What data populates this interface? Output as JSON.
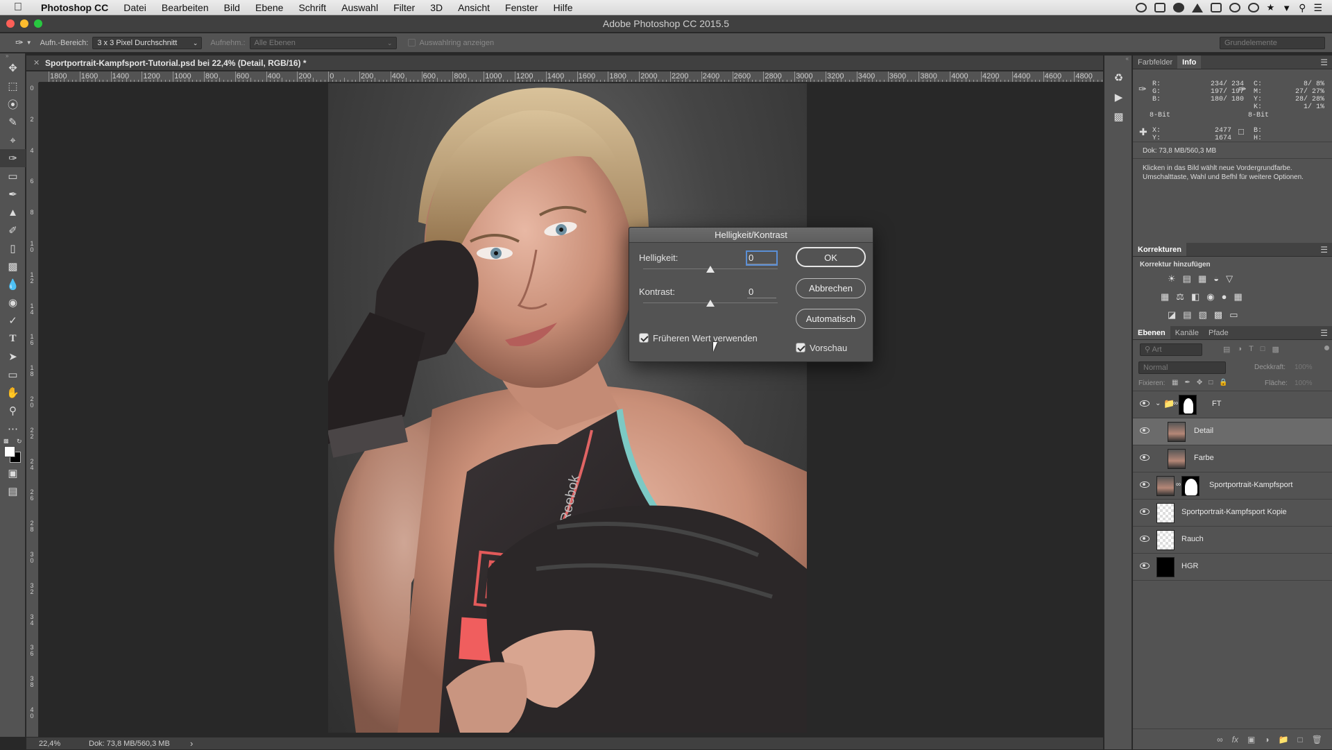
{
  "menubar": {
    "items": [
      "Photoshop CC",
      "Datei",
      "Bearbeiten",
      "Bild",
      "Ebene",
      "Schrift",
      "Auswahl",
      "Filter",
      "3D",
      "Ansicht",
      "Fenster",
      "Hilfe"
    ]
  },
  "window": {
    "title": "Adobe Photoshop CC 2015.5"
  },
  "options": {
    "sample_size_label": "Aufn.-Bereich:",
    "sample_size_value": "3 x 3 Pixel Durchschnitt",
    "sample_label": "Aufnehm.:",
    "sample_value": "Alle Ebenen",
    "show_ring_label": "Auswahlring anzeigen",
    "workspace": "Grundelemente"
  },
  "document": {
    "tab_title": "Sportportrait-Kampfsport-Tutorial.psd bei 22,4% (Detail, RGB/16) *",
    "ruler_h": [
      "1800",
      "1600",
      "1400",
      "1200",
      "1000",
      "800",
      "600",
      "400",
      "200",
      "0",
      "200",
      "400",
      "600",
      "800",
      "1000",
      "1200",
      "1400",
      "1600",
      "1800",
      "2000",
      "2200",
      "2400",
      "2600",
      "2800",
      "3000",
      "3200",
      "3400",
      "3600",
      "3800",
      "4000",
      "4200",
      "4400",
      "4600",
      "4800"
    ],
    "ruler_v": [
      "0",
      "2",
      "4",
      "6",
      "8",
      "1 0",
      "1 2",
      "1 4",
      "1 6",
      "1 8",
      "2 0",
      "2 2",
      "2 4",
      "2 6",
      "2 8",
      "3 0",
      "3 2",
      "3 4",
      "3 6",
      "3 8",
      "4 0"
    ],
    "photo_texts": {
      "brand": "Reebok",
      "shirt_print": "DY"
    }
  },
  "status": {
    "zoom": "22,4%",
    "doc": "Dok: 73,8 MB/560,3 MB",
    "arrow": "›"
  },
  "info_panel": {
    "tabs": [
      "Farbfelder",
      "Info"
    ],
    "rgb_labels": [
      "R:",
      "G:",
      "B:"
    ],
    "rgb_values": [
      "234/ 234",
      "197/ 197",
      "180/ 180"
    ],
    "cmyk_labels": [
      "C:",
      "M:",
      "Y:",
      "K:"
    ],
    "cmyk_values": [
      "8/ 8%",
      "27/ 27%",
      "28/ 28%",
      "1/ 1%"
    ],
    "bit_left": "8-Bit",
    "bit_right": "8-Bit",
    "xy_labels": [
      "X:",
      "Y:"
    ],
    "xy_values": [
      "2477",
      "1674"
    ],
    "bh_labels": [
      "B:",
      "H:"
    ],
    "doc": "Dok: 73,8 MB/560,3 MB",
    "hint": "Klicken in das Bild wählt neue Vordergrundfarbe. Umschalttaste, Wahl und Befhl für weitere Optionen."
  },
  "corrections_panel": {
    "tab": "Korrekturen",
    "subtitle": "Korrektur hinzufügen"
  },
  "layers_panel": {
    "tabs": [
      "Ebenen",
      "Kanäle",
      "Pfade"
    ],
    "filter_placeholder": "Art",
    "blend_mode": "Normal",
    "opacity_label": "Deckkraft:",
    "opacity_value": "100%",
    "lock_label": "Fixieren:",
    "fill_label": "Fläche:",
    "fill_value": "100%",
    "layers": [
      {
        "name": "FT",
        "type": "group",
        "selected": false
      },
      {
        "name": "Detail",
        "type": "photo",
        "selected": true
      },
      {
        "name": "Farbe",
        "type": "photo",
        "selected": false
      },
      {
        "name": "Sportportrait-Kampfsport",
        "type": "masked",
        "selected": false
      },
      {
        "name": "Sportportrait-Kampfsport Kopie",
        "type": "empty",
        "selected": false
      },
      {
        "name": "Rauch",
        "type": "empty",
        "selected": false
      },
      {
        "name": "HGR",
        "type": "black",
        "selected": false
      }
    ]
  },
  "dialog": {
    "title": "Helligkeit/Kontrast",
    "brightness_label": "Helligkeit:",
    "brightness_value": "0",
    "brightness_slider": 0.5,
    "contrast_label": "Kontrast:",
    "contrast_value": "0",
    "contrast_slider": 0.5,
    "legacy_label": "Früheren Wert verwenden",
    "legacy_checked": true,
    "preview_label": "Vorschau",
    "preview_checked": true,
    "ok": "OK",
    "cancel": "Abbrechen",
    "auto": "Automatisch"
  }
}
